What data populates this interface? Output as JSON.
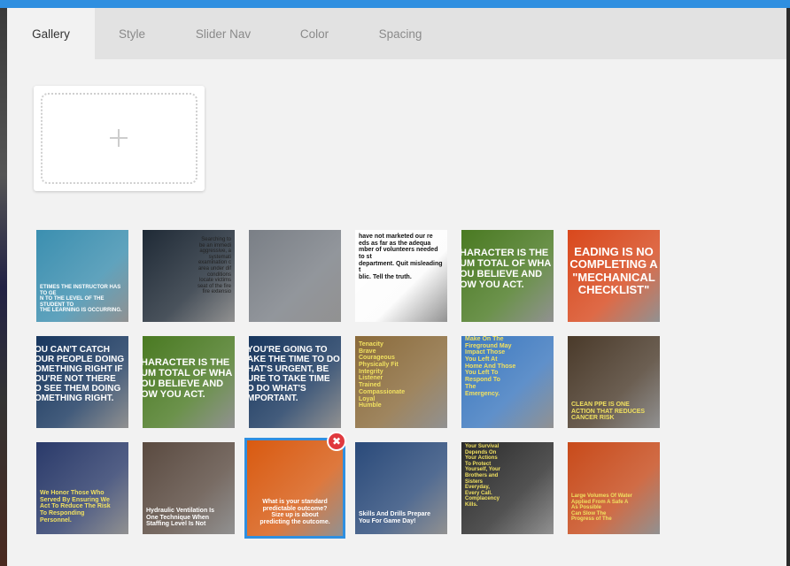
{
  "tabs": [
    {
      "label": "Gallery",
      "active": true
    },
    {
      "label": "Style",
      "active": false
    },
    {
      "label": "Slider Nav",
      "active": false
    },
    {
      "label": "Color",
      "active": false
    },
    {
      "label": "Spacing",
      "active": false
    }
  ],
  "upload": {
    "icon": "plus-icon"
  },
  "images": [
    {
      "caption": "ETIMES THE INSTRUCTOR HAS TO GE\nN TO THE LEVEL OF THE STUDENT TO\nTHE LEARNING IS OCCURRING.",
      "bg": "#3b8fb0",
      "color": "#ffffff"
    },
    {
      "caption": "Searching to\nbe an immedi\naggressive, a\nsystemati\nexamination c\narea under dif\nconditions\nlocate victims\nseat of the fire\nfire extensio",
      "bg": "#1f2a36",
      "color": "#222222"
    },
    {
      "caption": "",
      "bg": "#7a7f86",
      "color": "#ffffff"
    },
    {
      "caption": "have not marketed our re\neds as far as the adequa\nmber of volunteers needed to st\ndepartment. Quit misleading t\nblic. Tell the truth.",
      "bg": "#ffffff",
      "color": "#111111"
    },
    {
      "caption": "HARACTER IS THE\nUM TOTAL OF WHA\nOU BELIEVE AND\nOW YOU ACT.",
      "bg": "#4a7a22",
      "color": "#ffffff"
    },
    {
      "caption": "EADING IS NO\nCOMPLETING A\n\"MECHANICAL\nCHECKLIST\"",
      "bg": "#d9481c",
      "color": "#ffffff"
    },
    {
      "caption": "OU CAN'T CATCH\nOUR PEOPLE DOING\nOMETHING RIGHT IF\nOU'RE NOT THERE\nO SEE THEM DOING\nOMETHING RIGHT.",
      "bg": "#17365e",
      "color": "#ffffff"
    },
    {
      "caption": "HARACTER IS THE\nUM TOTAL OF WHA\nOU BELIEVE AND\nOW YOU ACT.",
      "bg": "#4a7a22",
      "color": "#ffffff"
    },
    {
      "caption": "YOU'RE GOING TO\nAKE THE TIME TO DO\nHAT'S URGENT, BE\nURE TO TAKE TIME\nO DO WHAT'S\nMPORTANT.",
      "bg": "#17365e",
      "color": "#ffffff"
    },
    {
      "caption": "Tenacity\nBrave\nCourageous\nPhysically Fit\nIntegrity\nListener\nTrained\nCompassionate\nLoyal\nHumble",
      "bg": "#8a6a3a",
      "color": "#f0e060"
    },
    {
      "caption": "Make On The\nFireground May\nImpact Those\nYou Left At\nHome And Those\nYou Left To\nRespond To\nThe\nEmergency.",
      "bg": "#3b78c0",
      "color": "#f0e060"
    },
    {
      "caption": "CLEAN PPE IS ONE\nACTION THAT REDUCES\nCANCER RISK",
      "bg": "#4a3a2a",
      "color": "#f0e060"
    },
    {
      "caption": "We Honor Those Who\nServed By Ensuring We\nAct To Reduce The Risk\nTo Responding\nPersonnel.",
      "bg": "#2a3a6a",
      "color": "#f0e060"
    },
    {
      "caption": "Hydraulic Ventilation Is\nOne Technique When\nStaffing Level Is Not",
      "bg": "#5a4a40",
      "color": "#ffffff"
    },
    {
      "caption": "What is your standard\npredictable outcome?\nSize up is about\npredicting the outcome.",
      "bg": "#d95a10",
      "color": "#ffffff"
    },
    {
      "caption": "Skills And Drills Prepare\nYou For Game Day!",
      "bg": "#2a4a7a",
      "color": "#ffffff"
    },
    {
      "caption": "Your Survival\nDepends On\nYour Actions\nTo Protect\nYourself, Your\nBrothers and\nSisters\nEveryday,\nEvery Call.\nComplacency\nKills.",
      "bg": "#2a2a2a",
      "color": "#f0e060"
    },
    {
      "caption": "Large Volumes Of Water\nApplied From A Safe A\nAs Possible\nCan Slow The\nProgress of The",
      "bg": "#c84a1a",
      "color": "#f0e060"
    }
  ],
  "selected_index": 14,
  "remove_icon": "close-icon",
  "colors": {
    "accent": "#2f8fe0",
    "remove": "#e0393e"
  }
}
